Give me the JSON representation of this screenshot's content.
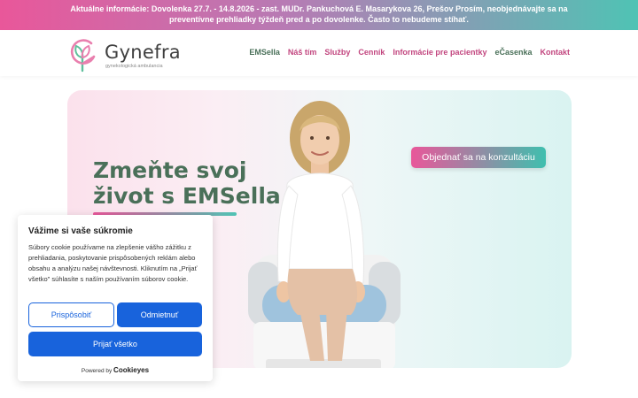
{
  "announcement": {
    "line1": "Aktuálne informácie: Dovolenka 27.7. - 14.8.2026 - zast. MUDr. Pankuchová E. Masarykova 26, Prešov Prosím, neobjednávajte sa na",
    "line2": "preventívne prehliadky týždeň pred a po dovolenke. Často to nebudeme stíhať."
  },
  "logo": {
    "name": "Gynefra",
    "subtitle": "gynekologická ambulancia"
  },
  "nav": {
    "items": [
      {
        "label": "EMSella",
        "color": "#4a7059"
      },
      {
        "label": "Náš tím",
        "color": "#c2467f"
      },
      {
        "label": "Služby",
        "color": "#c2467f"
      },
      {
        "label": "Cenník",
        "color": "#c2467f"
      },
      {
        "label": "Informácie pre pacientky",
        "color": "#c2467f"
      },
      {
        "label": "eČasenka",
        "color": "#4a7059"
      },
      {
        "label": "Kontakt",
        "color": "#c2467f"
      }
    ]
  },
  "hero": {
    "title_line1": "Zmeňte svoj",
    "title_line2": "život s EMSella",
    "cta": "Objednať sa na konzultáciu"
  },
  "cookie": {
    "title": "Vážime si vaše súkromie",
    "text": "Súbory cookie používame na zlepšenie vášho zážitku z prehliadania, poskytovanie prispôsobených reklám alebo obsahu a analýzu našej návštevnosti. Kliknutím na „Prijať všetko\" súhlasíte s naším používaním súborov cookie.",
    "customize_label": "Prispôsobiť",
    "reject_label": "Odmietnuť",
    "accept_label": "Prijať všetko",
    "powered_by": "Powered by",
    "brand": "Cookieyes"
  },
  "colors": {
    "brand_pink": "#e9579a",
    "brand_teal": "#4fc3b4",
    "brand_green": "#4a7059",
    "cookie_blue": "#1863dc"
  }
}
